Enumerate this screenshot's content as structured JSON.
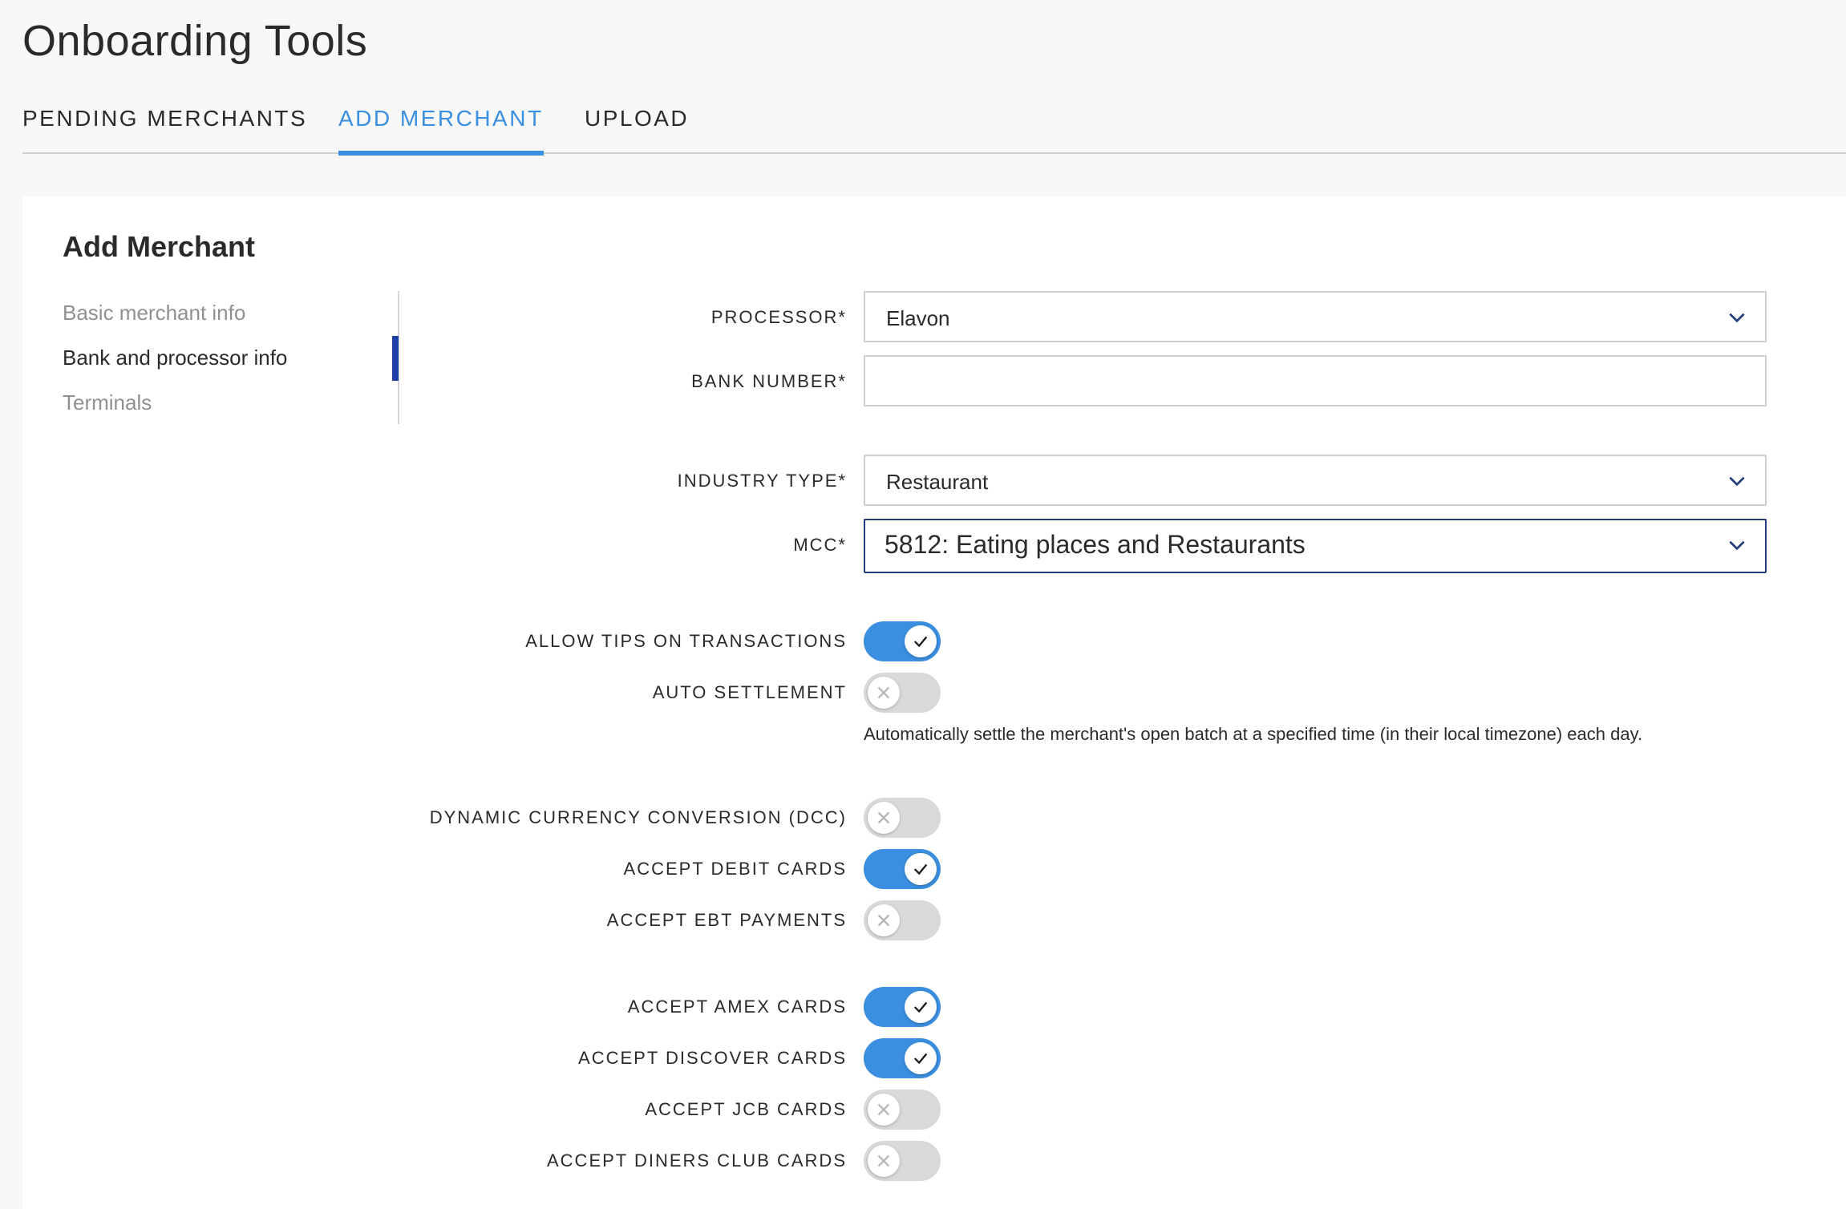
{
  "page": {
    "title": "Onboarding Tools"
  },
  "tabs": [
    {
      "label": "PENDING MERCHANTS"
    },
    {
      "label": "ADD MERCHANT"
    },
    {
      "label": "UPLOAD"
    }
  ],
  "card": {
    "title": "Add Merchant"
  },
  "side_nav": [
    {
      "label": "Basic merchant info"
    },
    {
      "label": "Bank and processor info"
    },
    {
      "label": "Terminals"
    }
  ],
  "form": {
    "processor": {
      "label": "PROCESSOR*",
      "value": "Elavon"
    },
    "bank_number": {
      "label": "BANK NUMBER*",
      "value": ""
    },
    "industry_type": {
      "label": "INDUSTRY TYPE*",
      "value": "Restaurant"
    },
    "mcc": {
      "label": "MCC*",
      "value": "5812: Eating places and Restaurants"
    },
    "toggles": {
      "allow_tips": {
        "label": "ALLOW TIPS ON TRANSACTIONS",
        "on": true
      },
      "auto_settlement": {
        "label": "AUTO SETTLEMENT",
        "on": false,
        "help": "Automatically settle the merchant's open batch at a specified time (in their local timezone) each day."
      },
      "dcc": {
        "label": "DYNAMIC CURRENCY CONVERSION (DCC)",
        "on": false
      },
      "debit": {
        "label": "ACCEPT DEBIT CARDS",
        "on": true
      },
      "ebt": {
        "label": "ACCEPT EBT PAYMENTS",
        "on": false
      },
      "amex": {
        "label": "ACCEPT AMEX CARDS",
        "on": true
      },
      "discover": {
        "label": "ACCEPT DISCOVER CARDS",
        "on": true
      },
      "jcb": {
        "label": "ACCEPT JCB CARDS",
        "on": false
      },
      "diners": {
        "label": "ACCEPT DINERS CLUB CARDS",
        "on": false
      }
    }
  },
  "colors": {
    "accent": "#3a8fe0",
    "nav_indicator": "#1f3ea8",
    "toggle_off": "#d9d9d9"
  }
}
